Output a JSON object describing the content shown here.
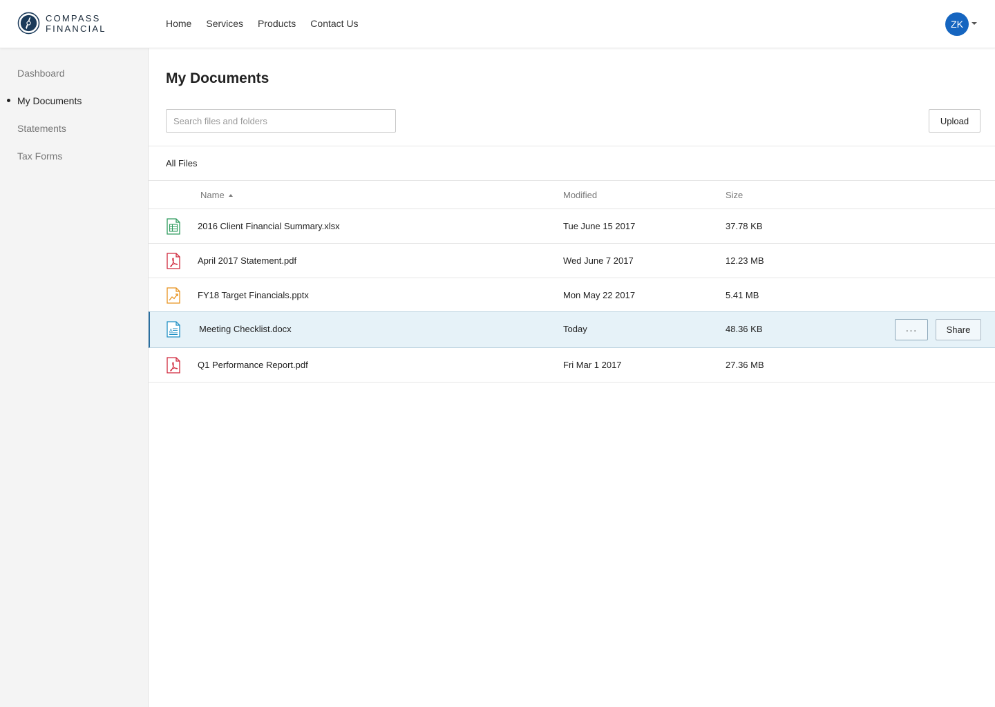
{
  "brand": {
    "line1": "COMPASS",
    "line2": "FINANCIAL",
    "logo_icon": "compass-logo-icon"
  },
  "nav": {
    "home": "Home",
    "services": "Services",
    "products": "Products",
    "contact": "Contact Us"
  },
  "user": {
    "initials": "ZK"
  },
  "sidebar": {
    "items": [
      {
        "label": "Dashboard"
      },
      {
        "label": "My Documents",
        "active": true
      },
      {
        "label": "Statements"
      },
      {
        "label": "Tax Forms"
      }
    ]
  },
  "main": {
    "title": "My Documents",
    "search_placeholder": "Search files and folders",
    "upload_label": "Upload",
    "breadcrumb": "All Files",
    "columns": {
      "name": "Name",
      "modified": "Modified",
      "size": "Size"
    },
    "files": [
      {
        "name": "2016 Client Financial Summary.xlsx",
        "modified": "Tue June 15 2017",
        "size": "37.78 KB",
        "icon": "spreadsheet-icon",
        "color": "#2e9b5e"
      },
      {
        "name": "April 2017 Statement.pdf",
        "modified": "Wed June 7 2017",
        "size": "12.23 MB",
        "icon": "pdf-icon",
        "color": "#d0283c"
      },
      {
        "name": "FY18 Target Financials.pptx",
        "modified": "Mon May 22 2017",
        "size": "5.41 MB",
        "icon": "presentation-icon",
        "color": "#e8921e"
      },
      {
        "name": "Meeting Checklist.docx",
        "modified": "Today",
        "size": "48.36 KB",
        "icon": "document-icon",
        "color": "#1e8fc4",
        "selected": true
      },
      {
        "name": "Q1 Performance Report.pdf",
        "modified": "Fri Mar 1 2017",
        "size": "27.36 MB",
        "icon": "pdf-icon",
        "color": "#d0283c"
      }
    ],
    "row_actions": {
      "more": "···",
      "share": "Share"
    }
  },
  "colors": {
    "accent": "#1565c0",
    "selected_row": "#e6f2f8",
    "selected_border": "#2a6fa0"
  }
}
